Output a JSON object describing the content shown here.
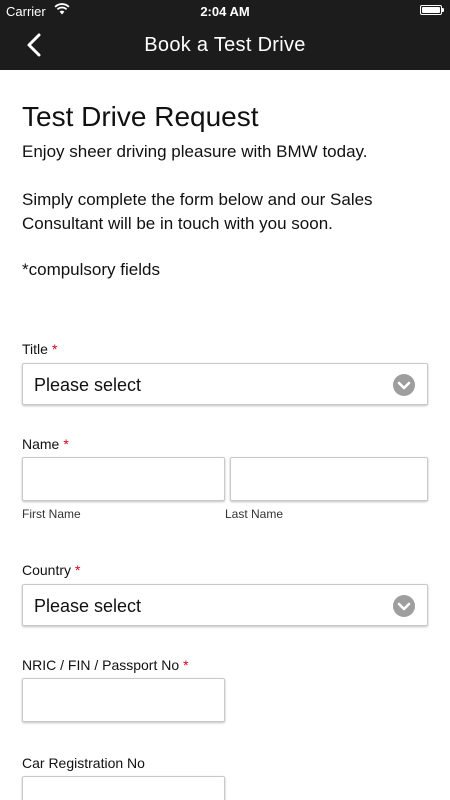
{
  "status_bar": {
    "carrier": "Carrier",
    "time": "2:04 AM"
  },
  "nav": {
    "title": "Book a Test Drive",
    "back_icon": "chevron-left-icon"
  },
  "page": {
    "heading": "Test Drive Request",
    "intro": "Enjoy sheer driving pleasure with BMW today.",
    "instructions": "Simply complete the form below and our Sales Consultant will be in touch with you soon.",
    "compulsory_note": "*compulsory fields"
  },
  "form": {
    "required_marker": "*",
    "required_color": "#d0021b",
    "title": {
      "label": "Title",
      "value": "Please select"
    },
    "name": {
      "label": "Name",
      "first_label": "First Name",
      "last_label": "Last Name",
      "first_value": "",
      "last_value": ""
    },
    "country": {
      "label": "Country",
      "value": "Please select"
    },
    "nric": {
      "label": "NRIC / FIN / Passport No",
      "value": ""
    },
    "car_reg": {
      "label": "Car Registration No",
      "value": ""
    }
  },
  "colors": {
    "nav_background": "#1c1c1c",
    "select_chevron": "#9e9e9e"
  }
}
